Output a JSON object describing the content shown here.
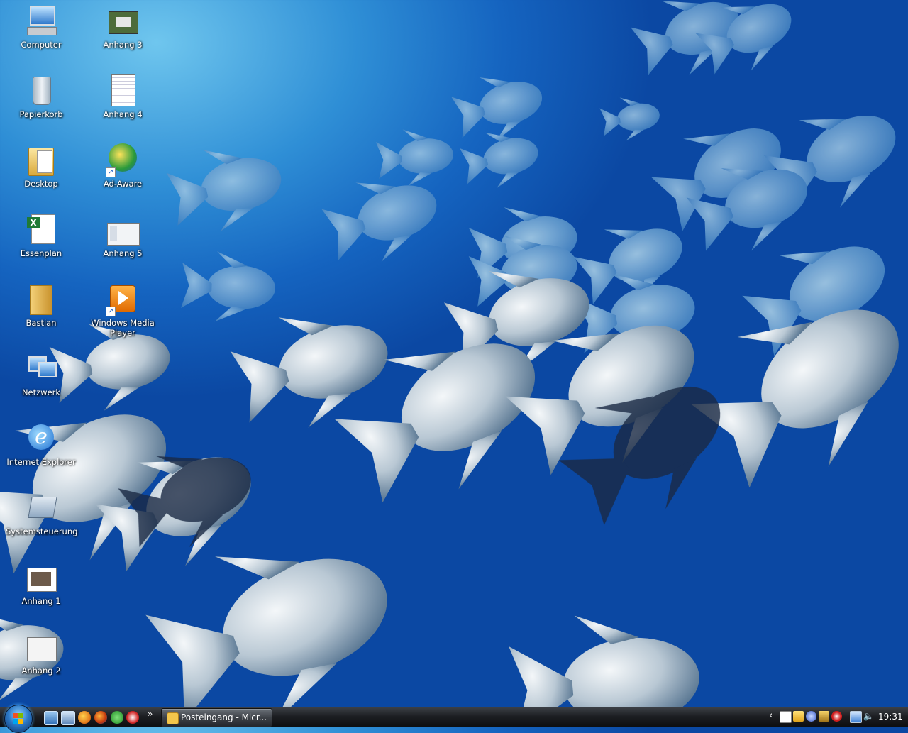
{
  "desktop": {
    "icons": [
      {
        "label": "Computer",
        "icon": "computer-icon"
      },
      {
        "label": "Papierkorb",
        "icon": "recycle-bin-icon"
      },
      {
        "label": "Desktop",
        "icon": "folder-icon"
      },
      {
        "label": "Essenplan",
        "icon": "excel-file-icon"
      },
      {
        "label": "Bastian",
        "icon": "folder-icon"
      },
      {
        "label": "Netzwerk",
        "icon": "network-icon"
      },
      {
        "label": "Internet Explorer",
        "icon": "internet-explorer-icon"
      },
      {
        "label": "Systemsteuerung",
        "icon": "control-panel-icon"
      },
      {
        "label": "Anhang 1",
        "icon": "image-file-icon"
      },
      {
        "label": "Anhang 2",
        "icon": "image-file-icon"
      },
      {
        "label": "Anhang 3",
        "icon": "image-file-icon"
      },
      {
        "label": "Anhang 4",
        "icon": "document-file-icon"
      },
      {
        "label": "Ad-Aware",
        "icon": "ad-aware-icon"
      },
      {
        "label": "Anhang 5",
        "icon": "image-file-icon"
      },
      {
        "label": "Windows Media Player",
        "icon": "media-player-icon"
      }
    ]
  },
  "taskbar": {
    "start_icon": "windows-start-orb-icon",
    "quick_launch_icons": [
      "show-desktop-icon",
      "switch-windows-icon",
      "thunderbird-icon",
      "firefox-icon",
      "clover-icon",
      "app-icon"
    ],
    "overflow_label": "»",
    "active_task": {
      "label": "Posteingang - Micr...",
      "icon": "mail-icon"
    },
    "tray_arrow": "‹",
    "tray_icons": [
      "connection-icon",
      "messenger-icon",
      "update-icon",
      "security-icon",
      "antivirus-icon",
      "network-status-icon",
      "volume-icon"
    ],
    "clock": "19:31"
  },
  "colors": {
    "sea_light": "#6fc6ee",
    "sea_dark": "#0b48a3",
    "fish": "#c9d4dc"
  }
}
